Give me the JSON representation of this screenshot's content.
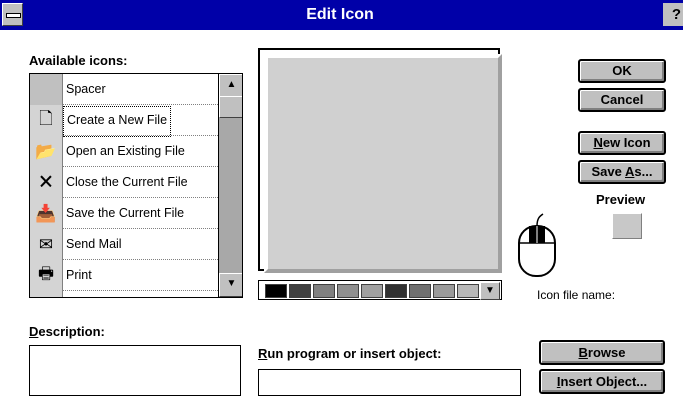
{
  "window": {
    "title": "Edit Icon",
    "help_glyph": "?"
  },
  "available_icons": {
    "label": "Available icons:",
    "items": [
      {
        "label": "Spacer",
        "icon": "blank-icon",
        "glyph": ""
      },
      {
        "label": "Create a New File",
        "icon": "new-file-icon",
        "glyph": "🗋",
        "selected": true
      },
      {
        "label": "Open an Existing File",
        "icon": "open-file-icon",
        "glyph": "📂"
      },
      {
        "label": "Close the Current File",
        "icon": "close-file-icon",
        "glyph": "🗙"
      },
      {
        "label": "Save the Current File",
        "icon": "save-file-icon",
        "glyph": "📥"
      },
      {
        "label": "Send Mail",
        "icon": "mail-icon",
        "glyph": "✉"
      },
      {
        "label": "Print",
        "icon": "printer-icon",
        "glyph": "🖶"
      }
    ],
    "scroll_up": "▲",
    "scroll_down": "▼"
  },
  "palette": {
    "colors": [
      "#000000",
      "#404040",
      "#808080",
      "#909090",
      "#a0a0a0",
      "#303030",
      "#707070",
      "#9a9a9a",
      "#b8b8b8"
    ],
    "dropdown_glyph": "▼"
  },
  "buttons": {
    "ok": "OK",
    "cancel": "Cancel",
    "new_icon_u": "N",
    "new_icon_rest": "ew Icon",
    "save_as_pre": "Save ",
    "save_as_u": "A",
    "save_as_rest": "s...",
    "browse_u": "B",
    "browse_rest": "rowse",
    "insert_u": "I",
    "insert_rest": "nsert Object..."
  },
  "preview": {
    "label": "Preview"
  },
  "icon_file_name": {
    "label": "Icon file name:",
    "value": ""
  },
  "description": {
    "label_u": "D",
    "label_rest": "escription:",
    "value": ""
  },
  "run_program": {
    "label_u": "R",
    "label_rest": "un program or insert object:",
    "value": ""
  }
}
